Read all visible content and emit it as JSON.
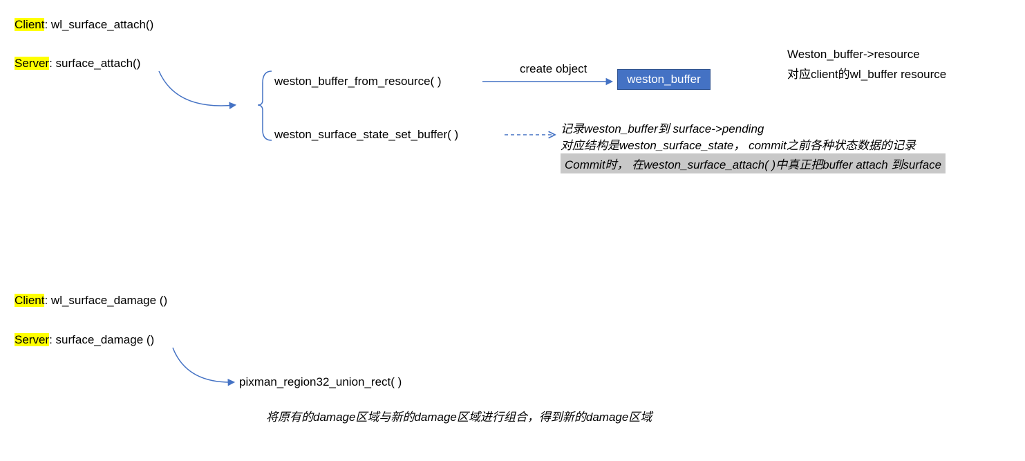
{
  "section1": {
    "clientLabel": "Client",
    "clientFn": ": wl_surface_attach()",
    "serverLabel": "Server",
    "serverFn": ": surface_attach()",
    "fn1": "weston_buffer_from_resource( )",
    "createObject": "create object",
    "bufferBox": "weston_buffer",
    "resourceTitle": "Weston_buffer->resource",
    "resourceNote": "对应client的wl_buffer resource",
    "fn2": "weston_surface_state_set_buffer( )",
    "note1": "记录weston_buffer到 surface->pending",
    "note2": "对应结构是weston_surface_state， commit之前各种状态数据的记录",
    "graynote": "Commit时， 在weston_surface_attach( )中真正把buffer attach 到surface"
  },
  "section2": {
    "clientLabel": "Client",
    "clientFn": ": wl_surface_damage ()",
    "serverLabel": "Server",
    "serverFn": ": surface_damage ()",
    "fn1": "pixman_region32_union_rect( )",
    "note": "将原有的damage区域与新的damage区域进行组合，得到新的damage区域"
  }
}
